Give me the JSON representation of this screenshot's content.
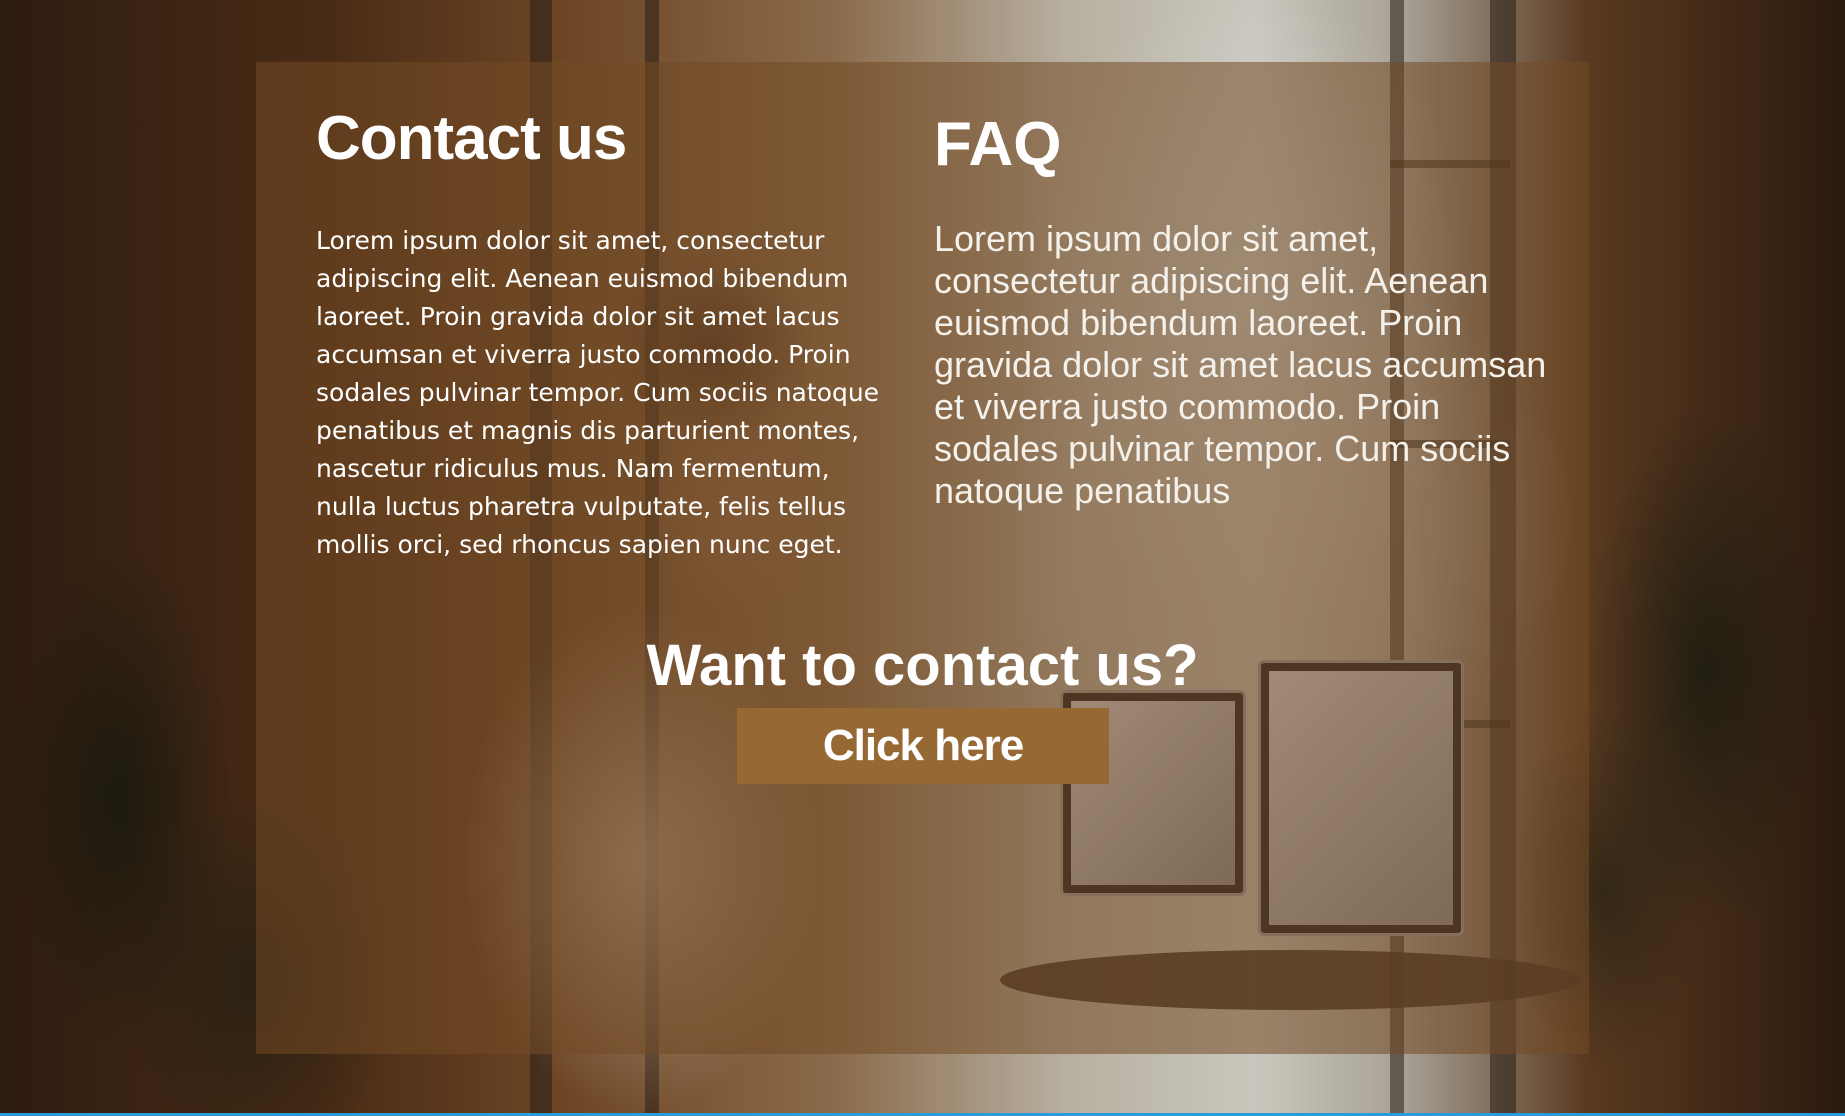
{
  "contact": {
    "heading": "Contact us",
    "body": "Lorem ipsum dolor sit amet, consectetur adipiscing elit. Aenean euismod bibendum laoreet. Proin gravida dolor sit amet lacus accumsan et viverra justo commodo. Proin sodales pulvinar tempor. Cum sociis natoque penatibus et magnis dis parturient montes, nascetur ridiculus mus. Nam fermentum, nulla luctus pharetra vulputate, felis tellus mollis orci, sed rhoncus sapien nunc eget."
  },
  "faq": {
    "heading": "FAQ",
    "body": "Lorem ipsum dolor sit amet, consectetur adipiscing elit. Aenean euismod bibendum laoreet. Proin gravida dolor sit amet lacus accumsan et viverra justo commodo. Proin sodales pulvinar tempor. Cum sociis natoque penatibus"
  },
  "cta": {
    "heading": "Want to contact us?",
    "button_label": "Click here"
  },
  "colors": {
    "panel_overlay": "#734a24",
    "button": "#956834",
    "text": "#ffffff"
  }
}
